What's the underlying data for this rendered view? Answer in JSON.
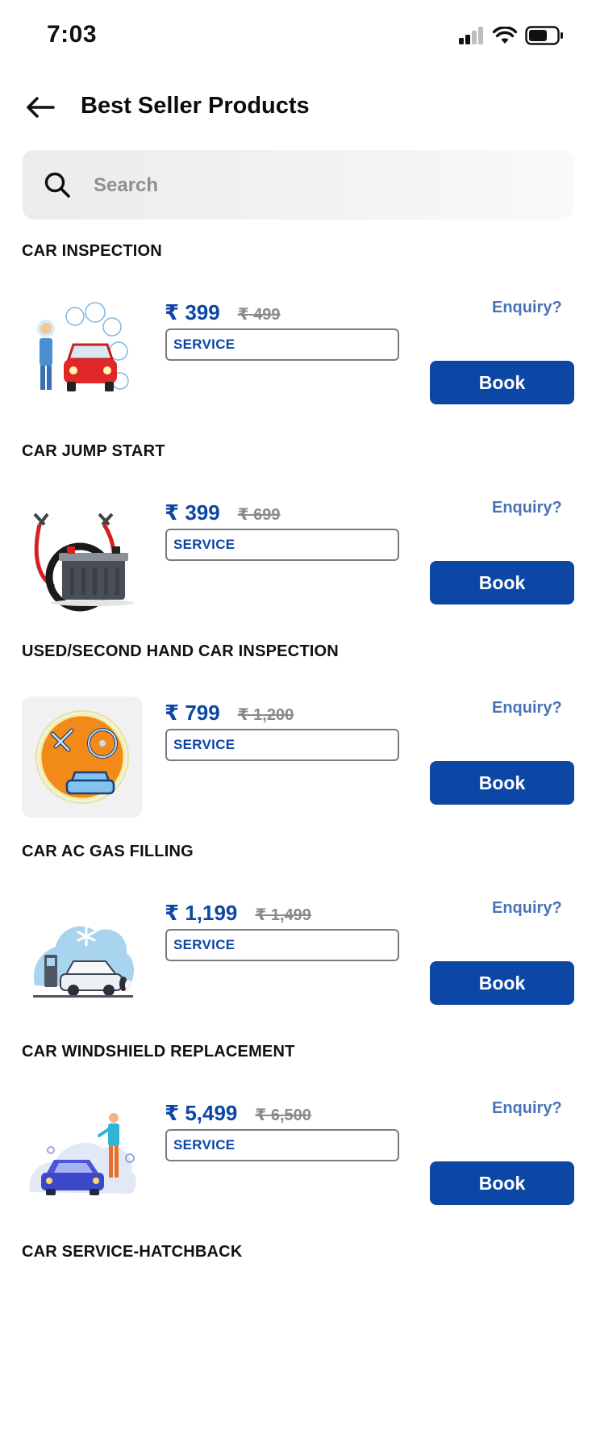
{
  "status_bar": {
    "time": "7:03",
    "icons": [
      "cellular-signal-icon",
      "wifi-icon",
      "battery-icon"
    ]
  },
  "header": {
    "title": "Best Seller Products",
    "back_icon": "back-arrow-icon"
  },
  "search": {
    "placeholder": "Search",
    "icon": "search-icon"
  },
  "colors": {
    "primary": "#0c47a6",
    "link": "#4a72b8",
    "strike": "#8a8a8a"
  },
  "products": [
    {
      "title": "CAR INSPECTION",
      "price": "₹ 399",
      "mrp": "₹ 499",
      "tag": "SERVICE",
      "enquiry": "Enquiry?",
      "button": "Book",
      "image": "car-inspection-illustration"
    },
    {
      "title": "CAR JUMP START",
      "price": "₹ 399",
      "mrp": "₹ 699",
      "tag": "SERVICE",
      "enquiry": "Enquiry?",
      "button": "Book",
      "image": "jump-start-battery-illustration"
    },
    {
      "title": "USED/SECOND HAND CAR INSPECTION",
      "price": "₹ 799",
      "mrp": "₹ 1,200",
      "tag": "SERVICE",
      "enquiry": "Enquiry?",
      "button": "Book",
      "image": "car-tools-badge-illustration"
    },
    {
      "title": "CAR AC GAS FILLING",
      "price": "₹ 1,199",
      "mrp": "₹ 1,499",
      "tag": "SERVICE",
      "enquiry": "Enquiry?",
      "button": "Book",
      "image": "car-ac-illustration"
    },
    {
      "title": "CAR WINDSHIELD REPLACEMENT",
      "price": "₹ 5,499",
      "mrp": "₹ 6,500",
      "tag": "SERVICE",
      "enquiry": "Enquiry?",
      "button": "Book",
      "image": "windshield-service-illustration"
    },
    {
      "title": "CAR SERVICE-HATCHBACK"
    }
  ]
}
